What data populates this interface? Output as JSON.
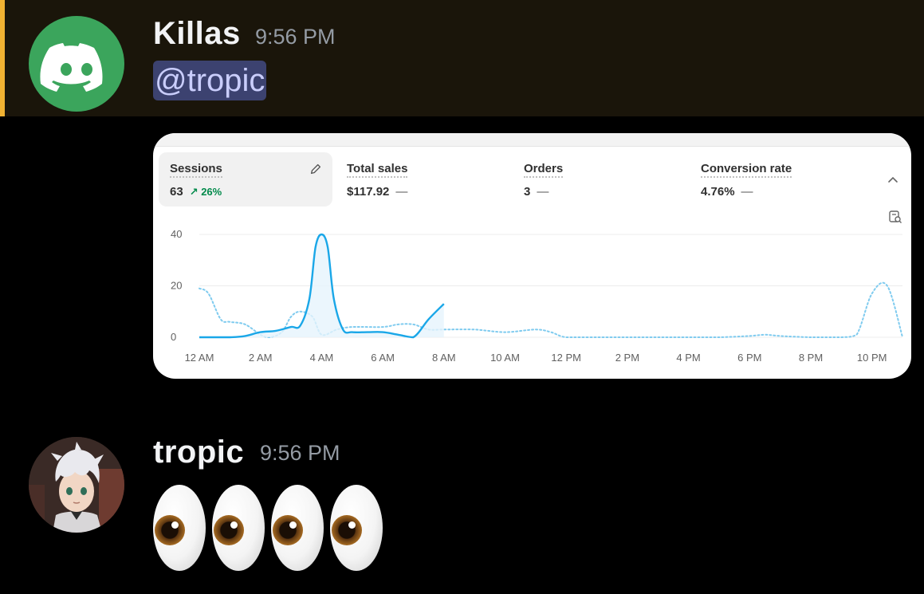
{
  "messages": [
    {
      "username": "Killas",
      "timestamp": "9:56 PM",
      "mention": "@tropic",
      "avatar": "discord-logo-icon"
    },
    {
      "username": "tropic",
      "timestamp": "9:56 PM",
      "avatar": "anime-character-avatar"
    }
  ],
  "emoji": [
    "eyes-emoji",
    "eyes-emoji",
    "eyes-emoji",
    "eyes-emoji"
  ],
  "colors": {
    "highlight_bg": "#1a150a",
    "highlight_bar": "#f0b232",
    "mention_bg": "#3c4270",
    "mention_text": "#c9cdfb",
    "series_today": "#1aa7e8",
    "series_prev": "#7fcbef",
    "positive": "#008a4a"
  },
  "dashboard": {
    "metrics": [
      {
        "label": "Sessions",
        "value": "63",
        "change": "26%",
        "change_dir": "up",
        "active": true
      },
      {
        "label": "Total sales",
        "value": "$117.92",
        "change": "—"
      },
      {
        "label": "Orders",
        "value": "3",
        "change": "—"
      },
      {
        "label": "Conversion rate",
        "value": "4.76%",
        "change": "—"
      }
    ]
  },
  "chart_data": {
    "type": "line",
    "x_labels": [
      "12 AM",
      "2 AM",
      "4 AM",
      "6 AM",
      "8 AM",
      "10 AM",
      "12 PM",
      "2 PM",
      "4 PM",
      "6 PM",
      "8 PM",
      "10 PM"
    ],
    "y_ticks": [
      0,
      20,
      40
    ],
    "ylim": [
      0,
      40
    ],
    "xlim": [
      0,
      23
    ],
    "grid": true,
    "series": [
      {
        "style": "solid",
        "x": [
          0,
          0.5,
          1,
          1.5,
          2,
          2.5,
          3,
          3.3,
          3.6,
          3.8,
          4,
          4.2,
          4.4,
          4.7,
          5,
          5.5,
          6,
          6.5,
          7,
          7.5,
          8
        ],
        "y": [
          0,
          0,
          0,
          0.5,
          2,
          2.5,
          4,
          4.5,
          15,
          35,
          40,
          35,
          15,
          3,
          2,
          2,
          2,
          1,
          0,
          7,
          13
        ]
      },
      {
        "style": "dotted",
        "x": [
          0,
          0.3,
          0.7,
          1,
          1.5,
          2,
          2.3,
          2.7,
          3,
          3.3,
          3.7,
          4,
          4.5,
          5,
          6,
          6.5,
          7,
          7.5,
          8,
          9,
          10,
          11,
          11.5,
          12,
          13,
          14,
          15,
          16,
          17,
          18,
          18.5,
          19,
          20,
          21,
          21.5,
          22,
          22.5,
          23
        ],
        "y": [
          19,
          17,
          7,
          6,
          5,
          1,
          0,
          2,
          8,
          10,
          8,
          1,
          3,
          4,
          4,
          5,
          5,
          3,
          3,
          3,
          2,
          3,
          2,
          0,
          0,
          0,
          0,
          0,
          0,
          0.5,
          1,
          0.5,
          0,
          0,
          1,
          17,
          20,
          0
        ]
      }
    ]
  }
}
